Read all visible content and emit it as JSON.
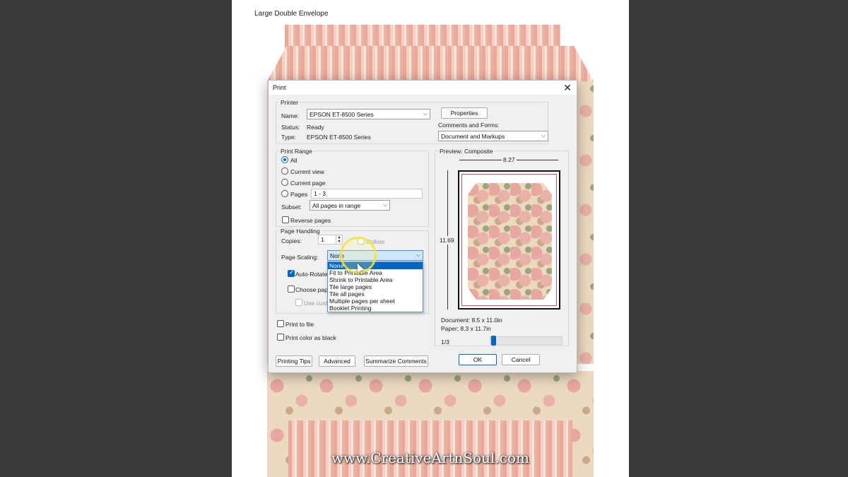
{
  "document": {
    "title": "Large Double Envelope",
    "watermark": "www.CreativeArtnSoul.com"
  },
  "dialog": {
    "title": "Print",
    "printer": {
      "group_label": "Printer",
      "name_label": "Name:",
      "name_value": "EPSON ET-8500 Series",
      "properties_label": "Properties",
      "status_label": "Status:",
      "status_value": "Ready",
      "type_label": "Type:",
      "type_value": "EPSON ET-8500 Series",
      "comments_label": "Comments and Forms:",
      "comments_value": "Document and Markups"
    },
    "print_range": {
      "group_label": "Print Range",
      "all_label": "All",
      "current_view_label": "Current view",
      "current_page_label": "Current page",
      "pages_label": "Pages",
      "pages_value": "1 - 3",
      "subset_label": "Subset:",
      "subset_value": "All pages in range",
      "reverse_label": "Reverse pages"
    },
    "page_handling": {
      "group_label": "Page Handling",
      "copies_label": "Copies:",
      "copies_value": "1",
      "collate_label": "Collate",
      "scaling_label": "Page Scaling:",
      "scaling_value": "None",
      "auto_rotate_label": "Auto-Rotate",
      "choose_paper_label": "Choose pape",
      "use_custom_label": "Use custo",
      "scaling_options": [
        "None",
        "Fit to Printable Area",
        "Shrink to Printable Area",
        "Tile large pages",
        "Tile all pages",
        "Multiple pages per sheet",
        "Booklet Printing"
      ]
    },
    "print_to_file_label": "Print to file",
    "print_color_black_label": "Print color as black",
    "preview": {
      "label": "Preview: Composite",
      "width": "8.27",
      "height": "11.69",
      "document_size": "Document: 8.5 x 11.0in",
      "paper_size": "Paper: 8.3 x 11.7in",
      "page_indicator": "1/3",
      "page_fraction": 0.33
    },
    "buttons": {
      "printing_tips": "Printing Tips",
      "advanced": "Advanced",
      "summarize": "Summarize Comments",
      "ok": "OK",
      "cancel": "Cancel"
    }
  },
  "colors": {
    "accent": "#0067c0"
  }
}
